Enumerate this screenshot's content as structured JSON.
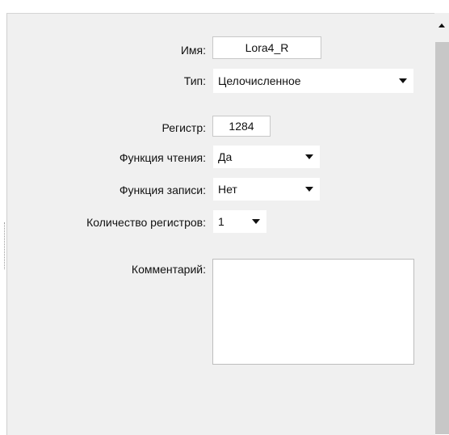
{
  "form": {
    "name_label": "Имя:",
    "name_value": "Lora4_R",
    "type_label": "Тип:",
    "type_value": "Целочисленное",
    "register_label": "Регистр:",
    "register_value": "1284",
    "read_label": "Функция чтения:",
    "read_value": "Да",
    "write_label": "Функция записи:",
    "write_value": "Нет",
    "count_label": "Количество регистров:",
    "count_value": "1",
    "comment_label": "Комментарий:",
    "comment_value": ""
  },
  "icons": {
    "dropdown": "chevron-down-icon",
    "scroll_up": "scroll-up-arrow-icon"
  }
}
